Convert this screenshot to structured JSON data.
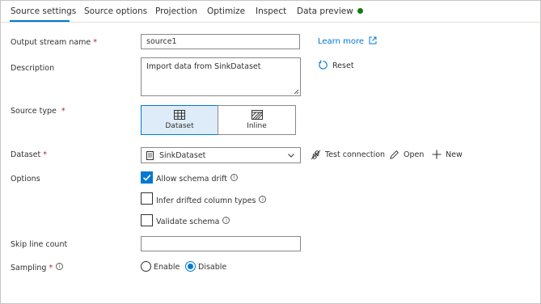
{
  "tabs": [
    {
      "label": "Source settings",
      "active": true
    },
    {
      "label": "Source options"
    },
    {
      "label": "Projection"
    },
    {
      "label": "Optimize"
    },
    {
      "label": "Inspect"
    },
    {
      "label": "Data preview"
    }
  ],
  "status_color": "#107c10",
  "accent_color": "#0078d4",
  "output_stream": {
    "label": "Output stream name",
    "required": "*",
    "value": "source1",
    "learn_more": "Learn more"
  },
  "description": {
    "label": "Description",
    "value": "Import data from SinkDataset",
    "reset": "Reset"
  },
  "source_type": {
    "label": "Source type",
    "required": "*",
    "options": [
      "Dataset",
      "Inline"
    ],
    "selected": "Dataset"
  },
  "dataset": {
    "label": "Dataset",
    "required": "*",
    "value": "SinkDataset",
    "test_connection": "Test connection",
    "open": "Open",
    "new": "New"
  },
  "options": {
    "label": "Options",
    "allow_schema_drift": {
      "label": "Allow schema drift",
      "checked": true
    },
    "infer_drifted": {
      "label": "Infer drifted column types",
      "checked": false
    },
    "validate_schema": {
      "label": "Validate schema",
      "checked": false
    }
  },
  "skip_line_count": {
    "label": "Skip line count",
    "value": ""
  },
  "sampling": {
    "label": "Sampling",
    "required": "*",
    "options": [
      "Enable",
      "Disable"
    ],
    "selected": "Disable"
  },
  "icons": [
    "external-link-icon",
    "reset-icon",
    "table-icon",
    "inline-grid-icon",
    "dataset-icon",
    "chevron-down-icon",
    "test-connection-icon",
    "pencil-icon",
    "plus-icon",
    "info-icon",
    "checkmark-icon"
  ]
}
